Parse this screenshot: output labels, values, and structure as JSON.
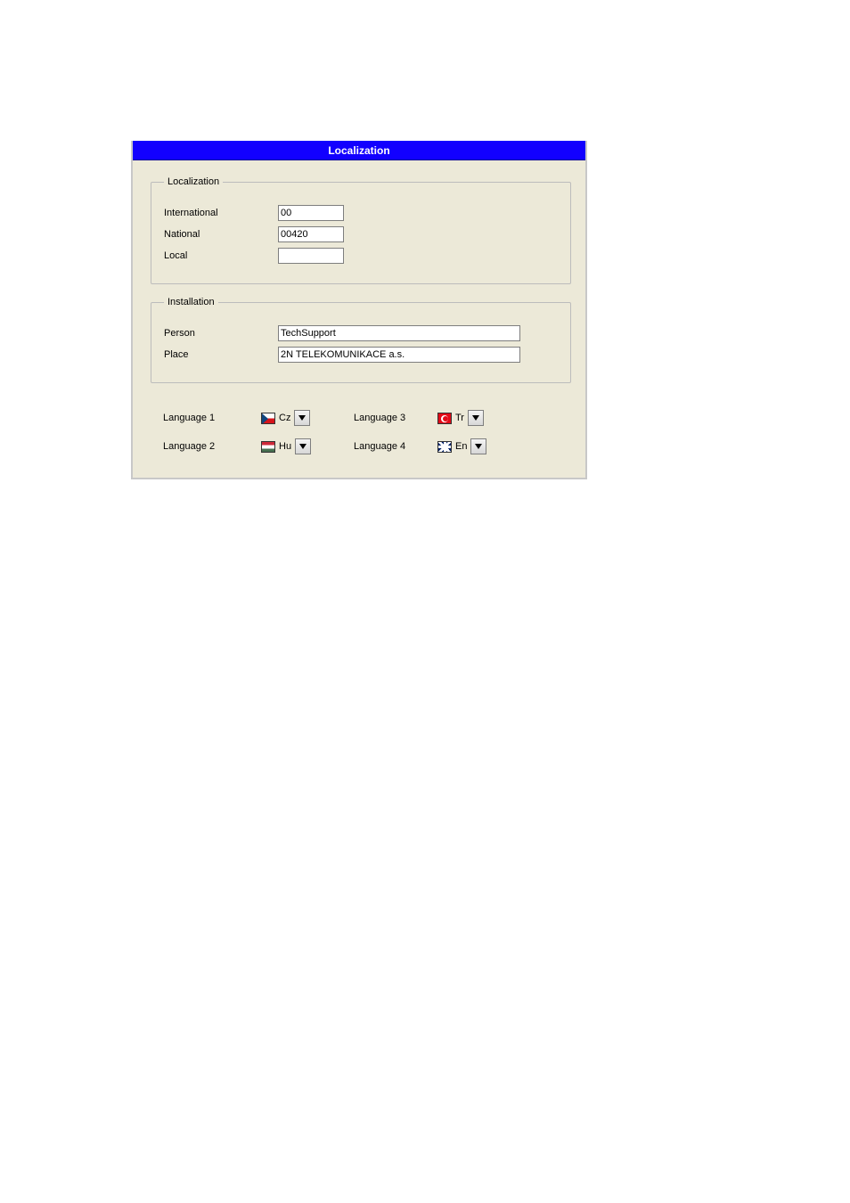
{
  "window": {
    "title": "Localization"
  },
  "localization": {
    "legend": "Localization",
    "rows": {
      "international": {
        "label": "International",
        "value": "00"
      },
      "national": {
        "label": "National",
        "value": "00420"
      },
      "local": {
        "label": "Local",
        "value": ""
      }
    }
  },
  "installation": {
    "legend": "Installation",
    "rows": {
      "person": {
        "label": "Person",
        "value": "TechSupport"
      },
      "place": {
        "label": "Place",
        "value": "2N TELEKOMUNIKACE a.s."
      }
    }
  },
  "languages": {
    "lang1": {
      "label": "Language 1",
      "code": "Cz",
      "flag": "cz"
    },
    "lang2": {
      "label": "Language 2",
      "code": "Hu",
      "flag": "hu"
    },
    "lang3": {
      "label": "Language 3",
      "code": "Tr",
      "flag": "tr"
    },
    "lang4": {
      "label": "Language 4",
      "code": "En",
      "flag": "en"
    }
  }
}
